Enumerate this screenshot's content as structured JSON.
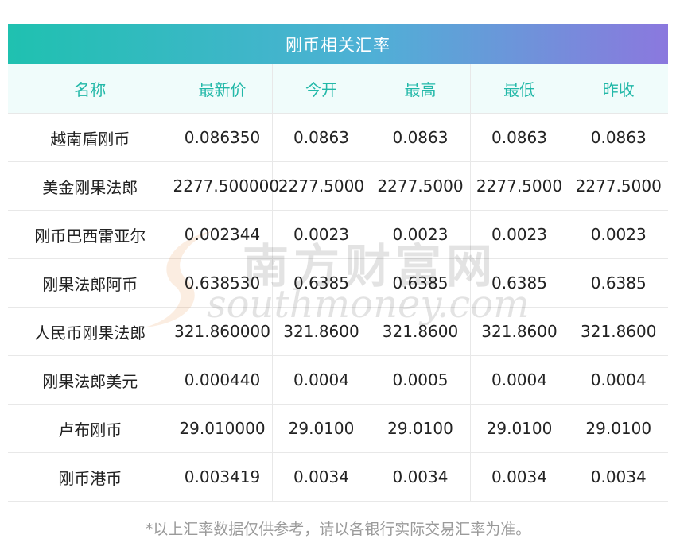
{
  "title": "刚币相关汇率",
  "columns": [
    "名称",
    "最新价",
    "今开",
    "最高",
    "最低",
    "昨收"
  ],
  "rows": [
    [
      "越南盾刚币",
      "0.086350",
      "0.0863",
      "0.0863",
      "0.0863",
      "0.0863"
    ],
    [
      "美金刚果法郎",
      "2277.500000",
      "2277.5000",
      "2277.5000",
      "2277.5000",
      "2277.5000"
    ],
    [
      "刚币巴西雷亚尔",
      "0.002344",
      "0.0023",
      "0.0023",
      "0.0023",
      "0.0023"
    ],
    [
      "刚果法郎阿币",
      "0.638530",
      "0.6385",
      "0.6385",
      "0.6385",
      "0.6385"
    ],
    [
      "人民币刚果法郎",
      "321.860000",
      "321.8600",
      "321.8600",
      "321.8600",
      "321.8600"
    ],
    [
      "刚果法郎美元",
      "0.000440",
      "0.0004",
      "0.0005",
      "0.0004",
      "0.0004"
    ],
    [
      "卢布刚币",
      "29.010000",
      "29.0100",
      "29.0100",
      "29.0100",
      "29.0100"
    ],
    [
      "刚币港币",
      "0.003419",
      "0.0034",
      "0.0034",
      "0.0034",
      "0.0034"
    ]
  ],
  "watermark": {
    "cn": "南方财富网",
    "en": "southmoney.com"
  },
  "footnote": "*以上汇率数据仅供参考，请以各银行实际交易汇率为准。",
  "colors": {
    "header_text": "#22b8a8",
    "header_bg": "#f0fcfb",
    "banner_start": "#1fc1b0",
    "banner_end": "#8b78de"
  }
}
